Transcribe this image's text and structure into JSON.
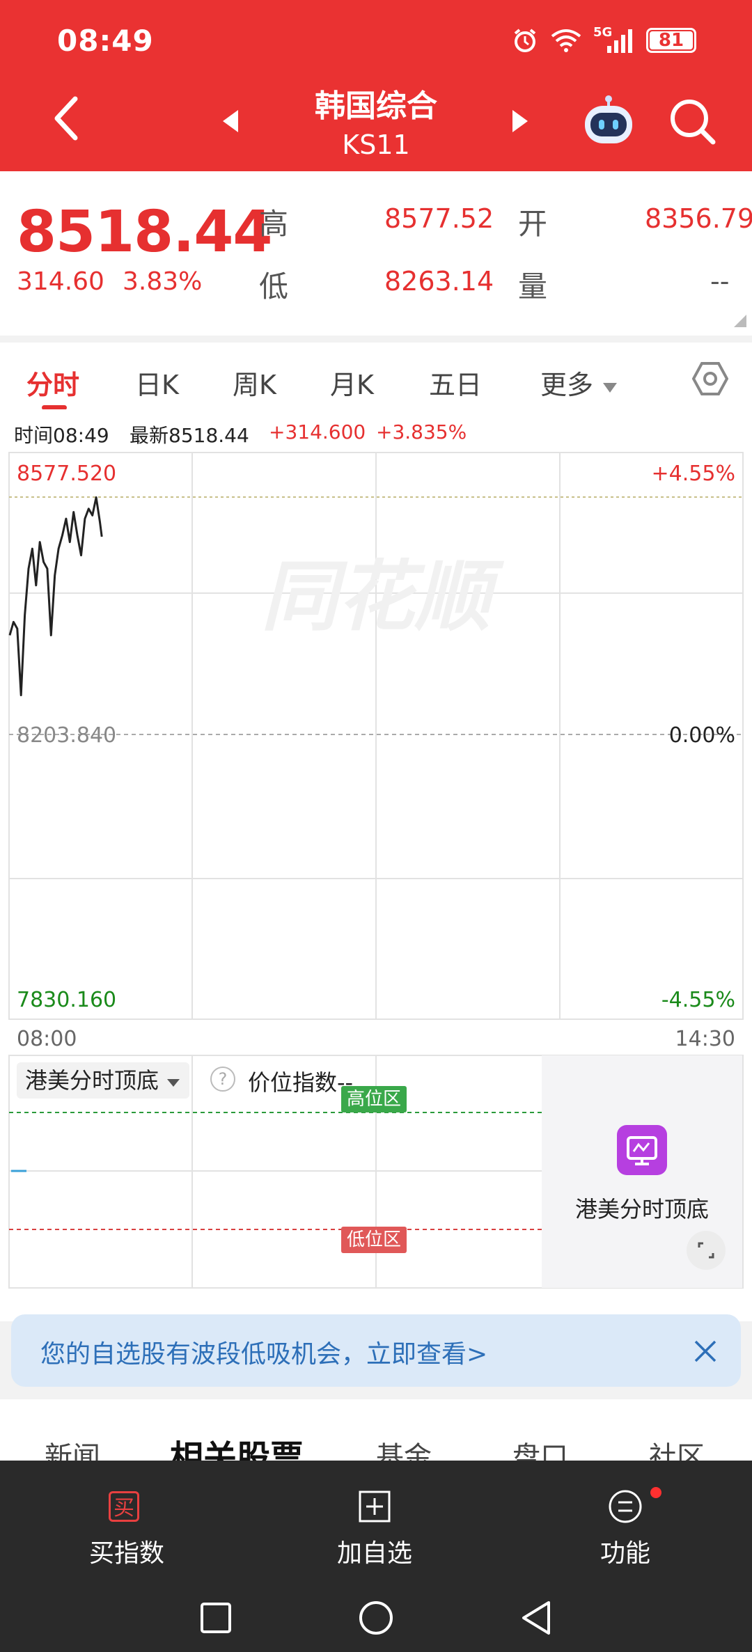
{
  "status": {
    "time": "08:49",
    "network": "5G",
    "battery": "81"
  },
  "header": {
    "title": "韩国综合",
    "code": "KS11"
  },
  "quote": {
    "price": "8518.44",
    "change": "314.60",
    "change_pct": "3.83%",
    "high_label": "高",
    "high": "8577.52",
    "open_label": "开",
    "open": "8356.79",
    "low_label": "低",
    "low": "8263.14",
    "volume_label": "量",
    "volume": "--"
  },
  "tabs": [
    "分时",
    "日K",
    "周K",
    "月K",
    "五日",
    "更多"
  ],
  "chart_info": {
    "time": "时间08:49",
    "latest": "最新8518.44",
    "change": "+314.600",
    "change_pct": "+3.835%"
  },
  "chart_data": {
    "type": "line",
    "x_start": "08:00",
    "x_end": "14:30",
    "y_top": "8577.520",
    "y_mid": "8203.840",
    "y_bottom": "7830.160",
    "pct_top": "+4.55%",
    "pct_mid": "0.00%",
    "pct_bottom": "-4.55%",
    "ylim": [
      7830.16,
      8577.52
    ],
    "x": [
      "08:00",
      "08:02",
      "08:04",
      "08:06",
      "08:08",
      "08:10",
      "08:12",
      "08:14",
      "08:16",
      "08:18",
      "08:20",
      "08:22",
      "08:24",
      "08:26",
      "08:28",
      "08:30",
      "08:32",
      "08:34",
      "08:36",
      "08:38",
      "08:40",
      "08:42",
      "08:44",
      "08:46",
      "08:48",
      "08:49"
    ],
    "values": [
      8370,
      8390,
      8380,
      8280,
      8400,
      8470,
      8500,
      8445,
      8510,
      8480,
      8470,
      8370,
      8460,
      8500,
      8520,
      8545,
      8510,
      8555,
      8520,
      8490,
      8545,
      8560,
      8550,
      8577,
      8540,
      8518
    ]
  },
  "indicator": {
    "name": "港美分时顶底",
    "help": "?",
    "price_index": "价位指数--",
    "high_zone": "高位区",
    "low_zone": "低位区",
    "promo_label": "港美分时顶底"
  },
  "banner": {
    "text": "您的自选股有波段低吸机会，立即查看>"
  },
  "bottom_tabs": [
    "新闻",
    "相关股票",
    "基金",
    "盘口",
    "社区"
  ],
  "bottom_bar": {
    "buy_icon": "买",
    "buy": "买指数",
    "add": "加自选",
    "func": "功能"
  }
}
